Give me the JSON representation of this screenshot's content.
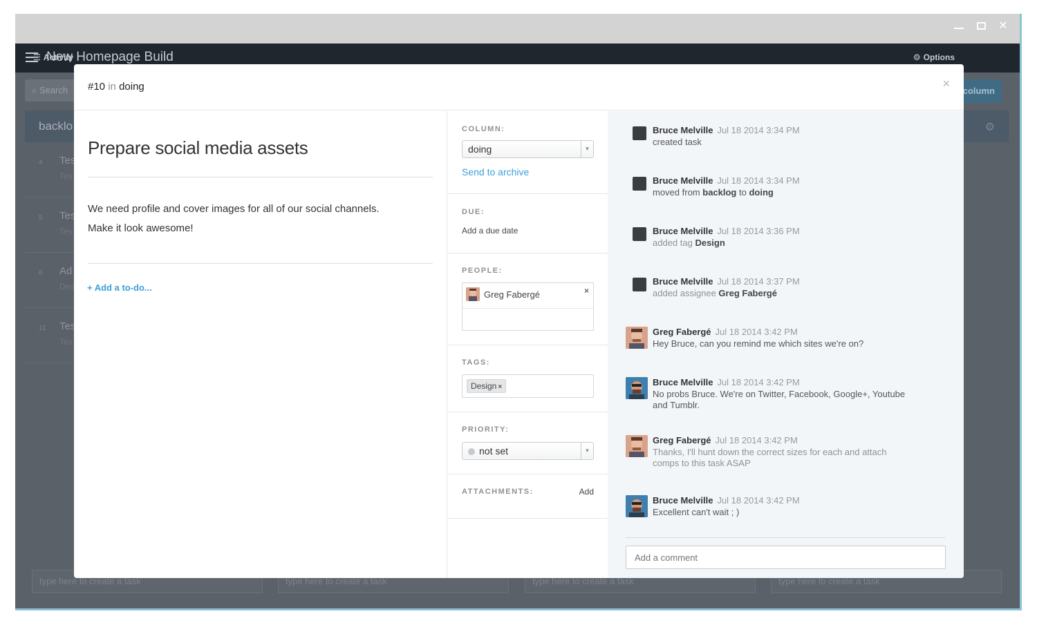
{
  "window": {
    "controls": {
      "minimize": "minimize-icon",
      "maximize": "maximize-icon",
      "close": "close-icon"
    }
  },
  "app": {
    "title": "New Homepage Build",
    "options_label": "Options",
    "activity_label": "Activity"
  },
  "board": {
    "search_placeholder": "Search",
    "new_column_label": "column",
    "column_name": "backlo",
    "rows": [
      {
        "num": "4",
        "title": "Tes",
        "sub": "Tes"
      },
      {
        "num": "5",
        "title": "Tes",
        "sub": "Tes"
      },
      {
        "num": "6",
        "title": "Ad",
        "sub": "Dev"
      },
      {
        "num": "11",
        "title": "Tes",
        "sub": "Tes"
      }
    ],
    "create_placeholder": "type here to create a task"
  },
  "modal": {
    "task_number": "#10",
    "in_label": "in",
    "column_name": "doing",
    "close_label": "×",
    "title": "Prepare social media assets",
    "description_line1": "We need profile and cover images for all of our social channels.",
    "description_line2": "Make it look awesome!",
    "add_todo": "+ Add a to-do..."
  },
  "details": {
    "column_label": "COLUMN:",
    "column_value": "doing",
    "send_to_archive": "Send to archive",
    "due_label": "DUE:",
    "due_value": "Add a due date",
    "people_label": "PEOPLE:",
    "person_name": "Greg Fabergé",
    "person_remove": "×",
    "tags_label": "TAGS:",
    "tag_name": "Design",
    "tag_remove": "×",
    "priority_label": "PRIORITY:",
    "priority_value": "not set",
    "attachments_label": "ATTACHMENTS:",
    "attachments_add": "Add"
  },
  "activity": [
    {
      "author": "Bruce Melville",
      "time": "Jul 18 2014 3:34 PM",
      "text_pre": "created task",
      "text_b1": "",
      "text_mid": "",
      "text_b2": ""
    },
    {
      "author": "Bruce Melville",
      "time": "Jul 18 2014 3:34 PM",
      "text_pre": "moved from ",
      "text_b1": "backlog",
      "text_mid": " to ",
      "text_b2": "doing"
    },
    {
      "author": "Bruce Melville",
      "time": "Jul 18 2014 3:36 PM",
      "text_pre": "added tag ",
      "text_b1": "Design",
      "text_mid": "",
      "text_b2": ""
    },
    {
      "author": "Bruce Melville",
      "time": "Jul 18 2014 3:37 PM",
      "text_pre": "added assignee ",
      "text_b1": "Greg Fabergé",
      "text_mid": "",
      "text_b2": ""
    },
    {
      "author": "Greg Fabergé",
      "time": "Jul 18 2014 3:42 PM",
      "text_pre": "Hey Bruce, can you remind me which sites we're on?",
      "text_b1": "",
      "text_mid": "",
      "text_b2": ""
    },
    {
      "author": "Bruce Melville",
      "time": "Jul 18 2014 3:42 PM",
      "text_pre": "No probs Bruce. We're on Twitter, Facebook, Google+, Youtube and Tumblr.",
      "text_b1": "",
      "text_mid": "",
      "text_b2": ""
    },
    {
      "author": "Greg Fabergé",
      "time": "Jul 18 2014 3:42 PM",
      "text_pre": "Thanks, I'll hunt down the correct sizes for each and attach comps to this task ASAP",
      "text_b1": "",
      "text_mid": "",
      "text_b2": ""
    },
    {
      "author": "Bruce Melville",
      "time": "Jul 18 2014 3:42 PM",
      "text_pre": "Excellent can't wait ; )",
      "text_b1": "",
      "text_mid": "",
      "text_b2": ""
    }
  ],
  "comment": {
    "placeholder": "Add a comment"
  },
  "colors": {
    "accent": "#3aa0d8",
    "app_bar": "#1f262e",
    "activity_bg": "#f3f6f9"
  }
}
